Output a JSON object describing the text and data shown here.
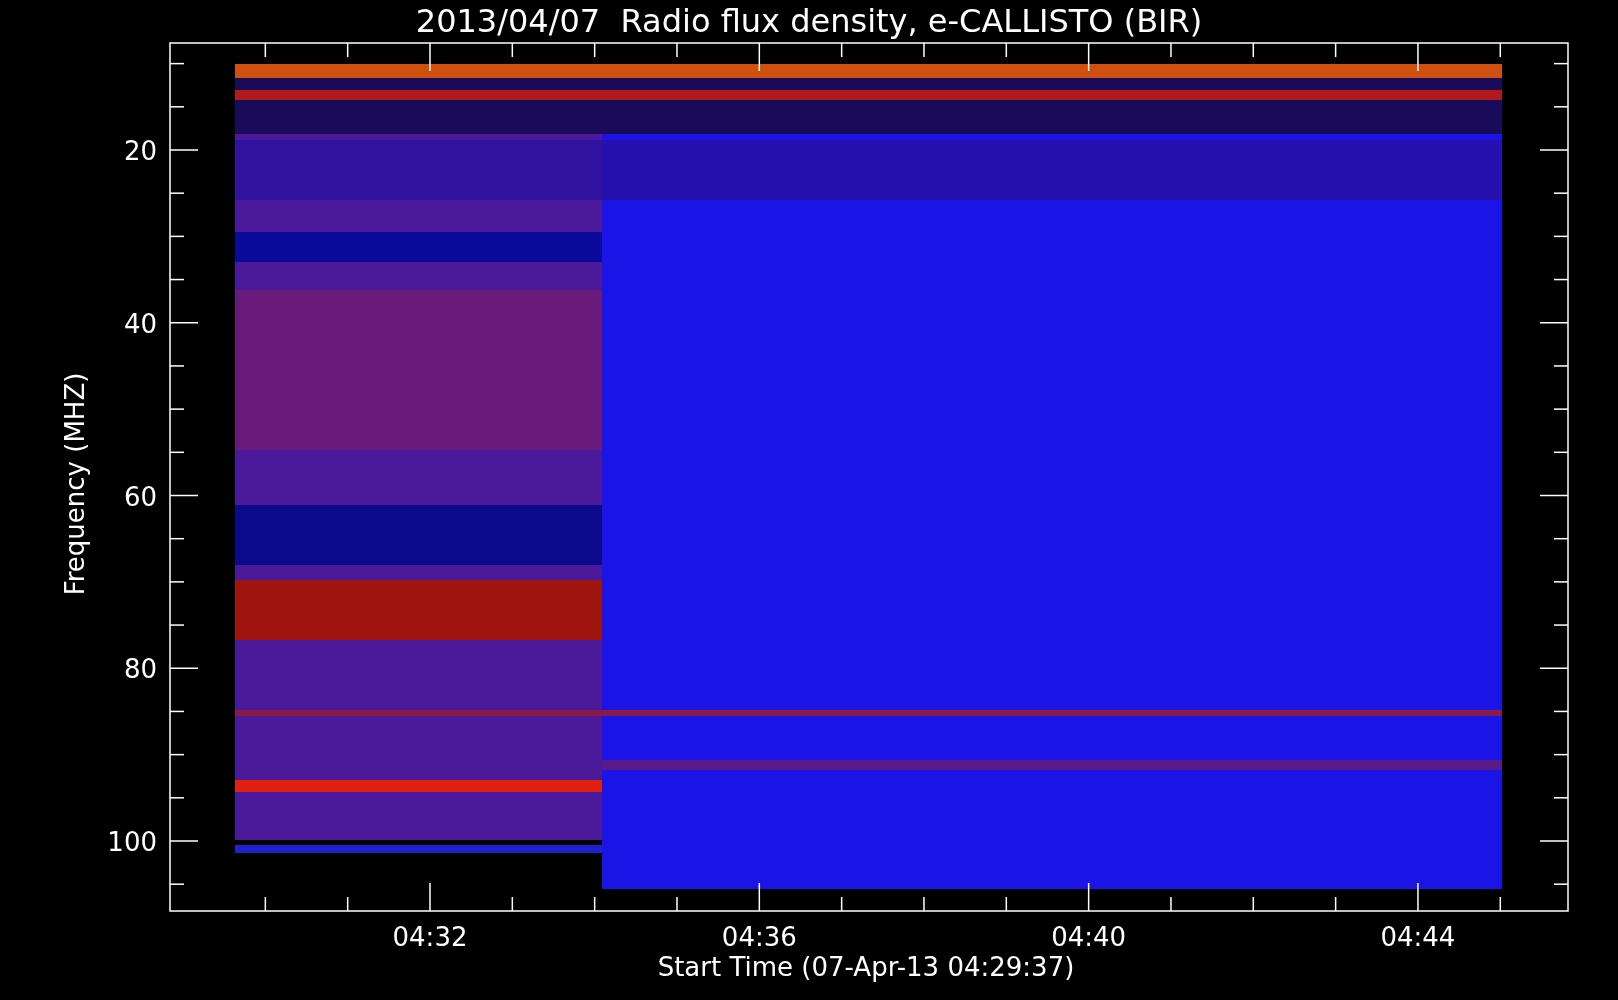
{
  "title": "2013/04/07  Radio flux density, e-CALLISTO (BIR)",
  "y_axis": {
    "label": "Frequency (MHZ)",
    "ticks": [
      "20",
      "40",
      "60",
      "80",
      "100"
    ]
  },
  "x_axis": {
    "label": "Start Time (07-Apr-13 04:29:37)",
    "ticks": [
      "04:32",
      "04:36",
      "04:40",
      "04:44"
    ]
  }
}
